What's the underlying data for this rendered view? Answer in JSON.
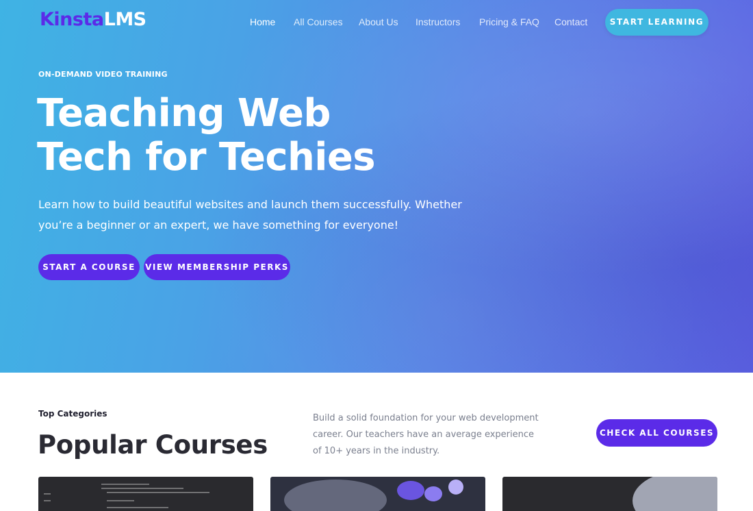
{
  "brand": {
    "part1": "Kinsta",
    "part2": "LMS",
    "accent_color": "#5b2be8"
  },
  "nav": {
    "items": [
      {
        "label": "Home"
      },
      {
        "label": "All Courses"
      },
      {
        "label": "About Us"
      },
      {
        "label": "Instructors"
      },
      {
        "label": "Pricing & FAQ"
      },
      {
        "label": "Contact"
      }
    ],
    "cta": "START LEARNING"
  },
  "hero": {
    "eyebrow": "ON-DEMAND VIDEO TRAINING",
    "title_line1": "Teaching Web",
    "title_line2": "Tech for Techies",
    "subtitle": "Learn how to build beautiful websites and launch them successfully. Whether you’re a beginner or an expert, we have something for everyone!",
    "primary_button": "START A COURSE",
    "secondary_button": "VIEW MEMBERSHIP PERKS"
  },
  "courses_section": {
    "eyebrow": "Top Categories",
    "title": "Popular Courses",
    "description": "Build a solid foundation for your web development career. Our teachers have an average experience of 10+ years in the industry.",
    "button": "CHECK ALL COURSES"
  },
  "colors": {
    "hero_gradient_start": "#3fb3e4",
    "hero_gradient_end": "#5c62e2",
    "button_purple": "#5b2be8",
    "button_cyan": "#3fb7e0"
  }
}
